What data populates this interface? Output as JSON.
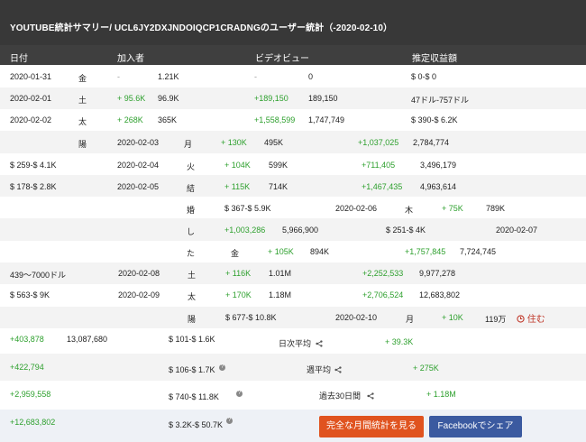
{
  "title": "YOUTUBE統計サマリー/ UCL6JY2DXJNDOIQCP1CRADNGのユーザー統計（-2020-02-10）",
  "headers": {
    "date": "日付",
    "subs": "加入者",
    "views": "ビデオビュー",
    "earnings": "推定収益額"
  },
  "rows": [
    {
      "c1": "2020-01-31",
      "c2": "金",
      "c3": "-",
      "c4": "1.21K",
      "c5": "-",
      "c6": "0",
      "c7": "$ 0-$ 0"
    },
    {
      "c1": "2020-02-01",
      "c2": "土",
      "c3": "+ 95.6K",
      "c4": "96.9K",
      "c5": "+189,150",
      "c6": "189,150",
      "c7": "47ドル-757ドル"
    },
    {
      "c1": "2020-02-02",
      "c2": "太",
      "c3": "+ 268K",
      "c4": "365K",
      "c5": "+1,558,599",
      "c6": "1,747,749",
      "c7": "$ 390-$ 6.2K"
    },
    {
      "c1": "陽",
      "c2": "2020-02-03",
      "c3": "月",
      "c4": "+ 130K",
      "c5": "495K",
      "c6": "+1,037,025",
      "c7": "2,784,774"
    },
    {
      "c1": "$ 259-$ 4.1K",
      "c2": "2020-02-04",
      "c3": "火",
      "c4": "+ 104K",
      "c5": "599K",
      "c6": "+711,405",
      "c7": "3,496,179"
    },
    {
      "c1": "$ 178-$ 2.8K",
      "c2": "2020-02-05",
      "c3": "結",
      "c4": "+ 115K",
      "c5": "714K",
      "c6": "+1,467,435",
      "c7": "4,963,614"
    },
    {
      "c1": "婚",
      "c2": "$ 367-$ 5.9K",
      "c3": "2020-02-06",
      "c4": "木",
      "c5": "+ 75K",
      "c6": "789K"
    },
    {
      "c1": "し",
      "c2": "+1,003,286",
      "c3": "5,966,900",
      "c4": "$ 251-$ 4K",
      "c5": "2020-02-07"
    },
    {
      "c1": "た",
      "c2": "金",
      "c3": "+ 105K",
      "c4": "894K",
      "c5": "+1,757,845",
      "c6": "7,724,745"
    },
    {
      "c1": "439〜7000ドル",
      "c2": "2020-02-08",
      "c3": "土",
      "c4": "+ 116K",
      "c5": "1.01M",
      "c6": "+2,252,533",
      "c7": "9,977,278"
    },
    {
      "c1": "$ 563-$ 9K",
      "c2": "2020-02-09",
      "c3": "太",
      "c4": "+ 170K",
      "c5": "1.18M",
      "c6": "+2,706,524",
      "c7": "12,683,802"
    },
    {
      "c1": "陽",
      "c2": "$ 677-$ 10.8K",
      "c3": "2020-02-10",
      "c4": "月",
      "c5": "+ 10K",
      "c6": "119万",
      "c7": "住む"
    }
  ],
  "summary": [
    {
      "views_delta": "+403,878",
      "views_total": "13,087,680",
      "earn": "$ 101-$ 1.6K",
      "label": "日次平均",
      "subs": "+ 39.3K"
    },
    {
      "views_delta": "+422,794",
      "earn": "$ 106-$ 1.7K",
      "label": "週平均",
      "subs": "+ 275K"
    },
    {
      "views_delta": "+2,959,558",
      "earn": "$ 740-$ 11.8K",
      "label": "過去30日間",
      "subs": "+ 1.18M"
    },
    {
      "views_delta": "+12,683,802",
      "earn": "$ 3.2K-$ 50.7K"
    }
  ],
  "buttons": {
    "monthly": "完全な月間統計を見る",
    "facebook": "Facebookでシェア"
  },
  "icons": {
    "share": "share-icon",
    "help": "help-icon",
    "clock": "clock-icon"
  },
  "colors": {
    "positive": "#2ea02e",
    "live": "#c0392b",
    "monthly_button": "#e0531f",
    "facebook_button": "#3b5aa0"
  }
}
